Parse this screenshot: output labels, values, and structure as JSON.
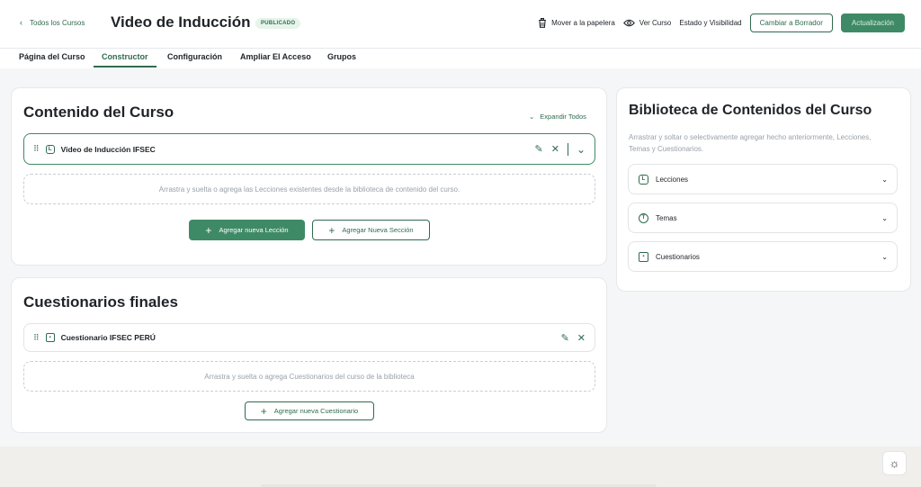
{
  "header": {
    "back_label": "Todos los Cursos",
    "title": "Video de Inducción",
    "status_badge": "PUBLICADO",
    "trash_label": "Mover a la papelera",
    "view_label": "Ver Curso",
    "visibility_label": "Estado y Visibilidad",
    "draft_button": "Cambiar a Borrador",
    "update_button": "Actualización"
  },
  "tabs": [
    {
      "label": "Página del Curso",
      "active": false
    },
    {
      "label": "Constructor",
      "active": true
    },
    {
      "label": "Configuración",
      "active": false
    },
    {
      "label": "Ampliar El Acceso",
      "active": false
    },
    {
      "label": "Grupos",
      "active": false
    }
  ],
  "content": {
    "title": "Contenido del Curso",
    "expand_label": "Expandir Todos",
    "section_row": {
      "label": "Video de Inducción IFSEC",
      "icon": "lesson-L"
    },
    "drop_text": "Arrastra y suelta o agrega las Lecciones existentes desde la biblioteca de contenido del curso.",
    "add_lesson": "Agregar nueva Lección",
    "add_section": "Agregar Nueva Sección"
  },
  "quizzes": {
    "title": "Cuestionarios finales",
    "quiz_row": {
      "label": "Cuestionario IFSEC PERÚ",
      "icon": "quiz-icon"
    },
    "drop_text": "Arrastra y suelta o agrega Cuestionarios del curso de la biblioteca",
    "add_quiz": "Agregar nueva Cuestionario"
  },
  "library": {
    "title": "Biblioteca de Contenidos del Curso",
    "description": "Arrastrar y soltar o selectivamente agregar hecho anteriormente, Lecciones, Temas y Cuestionarios.",
    "items": [
      {
        "label": "Lecciones",
        "icon": "L"
      },
      {
        "label": "Temas",
        "icon": "T"
      },
      {
        "label": "Cuestionarios",
        "icon": "quiz"
      }
    ]
  },
  "colors": {
    "accent": "#2f6b4f",
    "accent_button": "#3f8a66",
    "background": "#f4f6f8",
    "footer": "#f1efeb"
  }
}
